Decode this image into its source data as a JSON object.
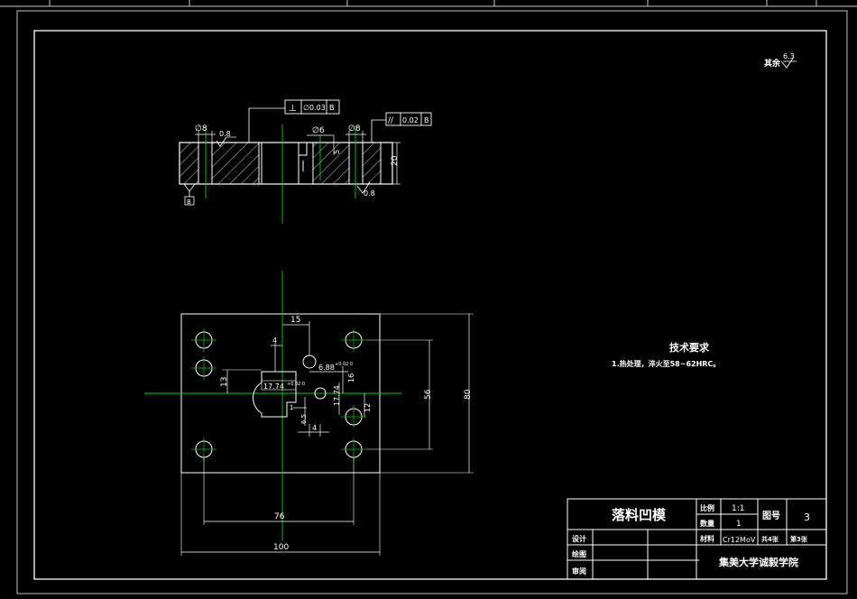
{
  "top_strip_ticks": 8,
  "roughness_general": {
    "prefix": "其余",
    "value": "6.3"
  },
  "section_view": {
    "perp_tolerance": {
      "symbol": "⊥",
      "value": "∅0.03",
      "datum": "B"
    },
    "parallel_tolerance": {
      "symbol": "//",
      "value": "0.02",
      "datum": "B"
    },
    "dia_left": "∅8",
    "dia_mid": "∅6",
    "dia_right": "∅8",
    "rough_left": "0.8",
    "rough_right": "0.8",
    "dim_height": "20",
    "dim_small": "5",
    "datum_label": "B"
  },
  "plan_view": {
    "dim_15": "15",
    "dim_4_top": "4",
    "dim_6_88": "6.88",
    "dim_6_88_tol": "+0.02 0",
    "dim_13": "13",
    "dim_16": "16",
    "dim_17_74": "17.74",
    "dim_17_74_tol": "+0.02 0",
    "dim_17_74_v": "17.74",
    "dim_12": "12",
    "dim_1": "1",
    "dim_6_5": "6.5",
    "dim_4_bottom": "4",
    "dim_56": "56",
    "dim_80": "80",
    "dim_76": "76",
    "dim_100": "100"
  },
  "tech_requirements": {
    "title": "技术要求",
    "items": [
      "1.热处理，淬火至58~62HRC。"
    ]
  },
  "title_block": {
    "part_name": "落料凹模",
    "scale_label": "比例",
    "scale_value": "1:1",
    "qty_label": "数量",
    "qty_value": "1",
    "drawing_no_label": "图号",
    "drawing_no_value": "3",
    "material_label": "材料",
    "material_value": "Cr12MoV",
    "sheets_total": "共4张",
    "sheet_no": "第3张",
    "design_label": "设计",
    "draw_label": "绘图",
    "review_label": "审阅",
    "school": "集美大学诚毅学院"
  }
}
